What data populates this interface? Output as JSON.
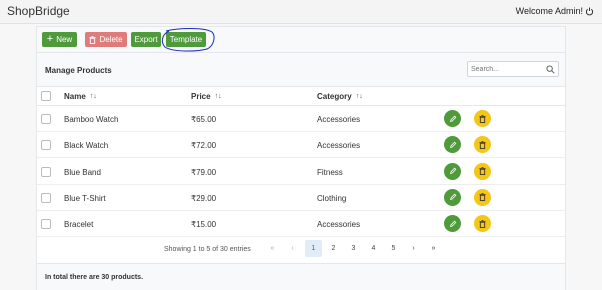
{
  "app": {
    "brand": "ShopBridge",
    "welcome": "Welcome Admin!"
  },
  "toolbar": {
    "new_label": "New",
    "delete_label": "Delete",
    "export_label": "Export",
    "template_label": "Template"
  },
  "table": {
    "title": "Manage Products",
    "search_placeholder": "Search...",
    "columns": {
      "name": "Name",
      "price": "Price",
      "category": "Category"
    },
    "rows": [
      {
        "name": "Bamboo Watch",
        "price": "₹65.00",
        "category": "Accessories"
      },
      {
        "name": "Black Watch",
        "price": "₹72.00",
        "category": "Accessories"
      },
      {
        "name": "Blue Band",
        "price": "₹79.00",
        "category": "Fitness"
      },
      {
        "name": "Blue T-Shirt",
        "price": "₹29.00",
        "category": "Clothing"
      },
      {
        "name": "Bracelet",
        "price": "₹15.00",
        "category": "Accessories"
      }
    ]
  },
  "pagination": {
    "summary": "Showing 1 to 5 of 30 entries",
    "first": "«",
    "prev": "‹",
    "pages": [
      "1",
      "2",
      "3",
      "4",
      "5"
    ],
    "current": "1",
    "next": "›",
    "last": "»"
  },
  "footer": {
    "total_text": "In total there are 30 products."
  },
  "colors": {
    "primary_green": "#4f9a3a",
    "delete_red": "#e07b7b",
    "warning_yellow": "#f5c518",
    "annotation_blue": "#1a2bb8"
  }
}
